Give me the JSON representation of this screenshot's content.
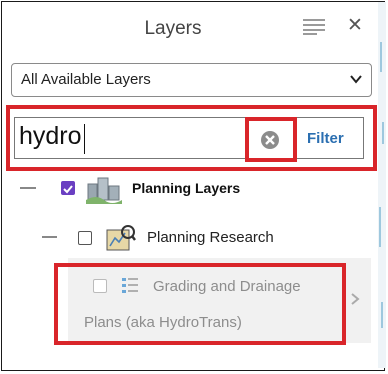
{
  "panel": {
    "title": "Layers"
  },
  "icons": {
    "menu": "hamburger-menu-icon",
    "close": "close-icon",
    "select_chevron": "chevron-down-icon",
    "clear": "clear-circle-x-icon",
    "planning_layers": "buildings-group-icon",
    "planning_research": "research-map-icon",
    "grading": "list-legend-icon",
    "expand": "chevron-right-icon"
  },
  "layer_select": {
    "selected": "All Available Layers"
  },
  "search": {
    "value": "hydro",
    "filter_label": "Filter"
  },
  "tree": {
    "group": {
      "label": "Planning Layers",
      "checked": true
    },
    "subgroup": {
      "label": "Planning Research",
      "checked": false
    },
    "item": {
      "label_line1": "Grading and Drainage",
      "label_line2": "Plans (aka HydroTrans)",
      "checked": false
    }
  },
  "colors": {
    "highlight": "#d9252a",
    "accent": "#6a3fc2",
    "link": "#2b6fb1"
  }
}
